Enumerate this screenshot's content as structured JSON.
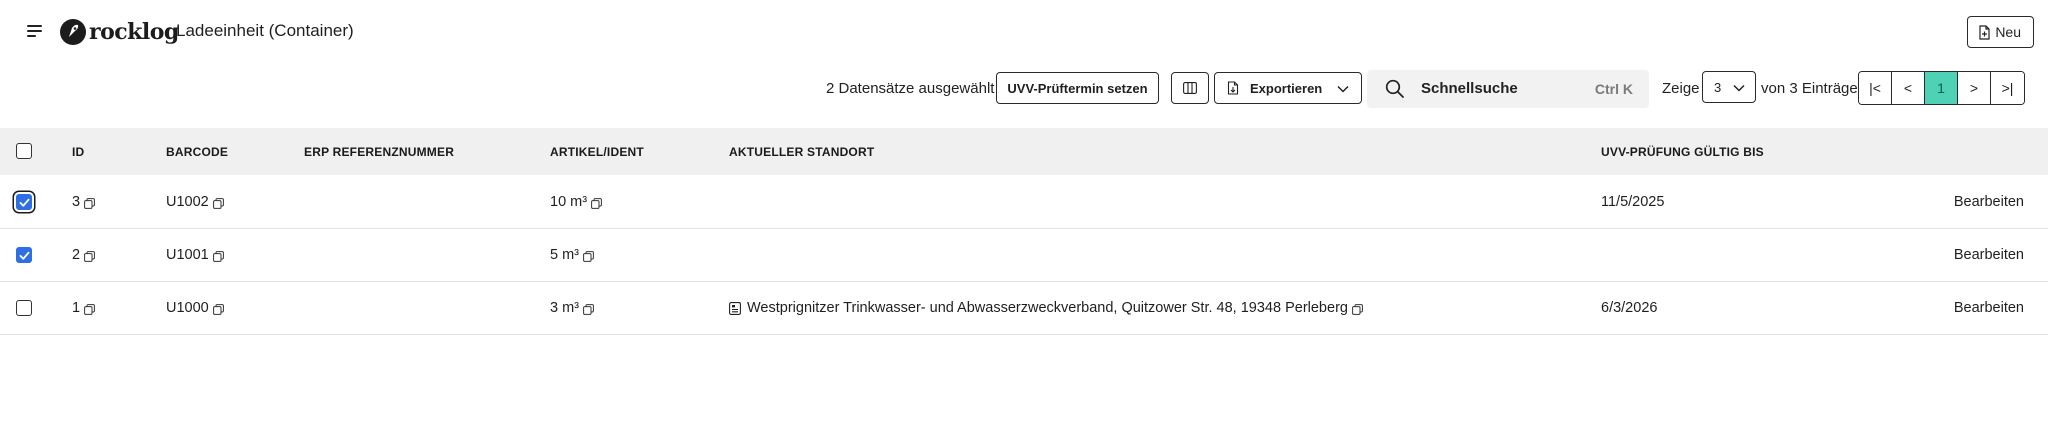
{
  "header": {
    "logo_text": "rocklog",
    "title": "Ladeeinheit (Container)",
    "new_label": "Neu"
  },
  "toolbar": {
    "selected_text": "2 Datensätze ausgewählt",
    "uvv_button": "UVV-Prüftermin setzen",
    "export_label": "Exportieren",
    "search_label": "Schnellsuche",
    "search_shortcut": "Ctrl K",
    "show_label": "Zeige",
    "page_size": "3",
    "count_text": "von 3 Einträge",
    "pager": [
      "|<",
      "<",
      "1",
      ">",
      ">|"
    ],
    "active_page": "1"
  },
  "table": {
    "columns": [
      "ID",
      "BARCODE",
      "ERP REFERENZNUMMER",
      "ARTIKEL/IDENT",
      "AKTUELLER STANDORT",
      "UVV-PRÜFUNG GÜLTIG BIS"
    ],
    "edit_label": "Bearbeiten",
    "rows": [
      {
        "id": "3",
        "barcode": "U1002",
        "erp": "",
        "artikel": "10 m³",
        "standort": "",
        "uvv": "11/5/2025",
        "selected": true
      },
      {
        "id": "2",
        "barcode": "U1001",
        "erp": "",
        "artikel": "5 m³",
        "standort": "",
        "uvv": "",
        "selected": true
      },
      {
        "id": "1",
        "barcode": "U1000",
        "erp": "",
        "artikel": "3 m³",
        "standort": "Westprignitzer Trinkwasser- und Abwasserzweckverband, Quitzower Str. 48, 19348 Perleberg",
        "uvv": "6/3/2026",
        "selected": false
      }
    ]
  },
  "colors": {
    "accent": "#4fd1b5",
    "checkbox": "#2f6fe4",
    "header_bg": "#f0f0f0"
  }
}
